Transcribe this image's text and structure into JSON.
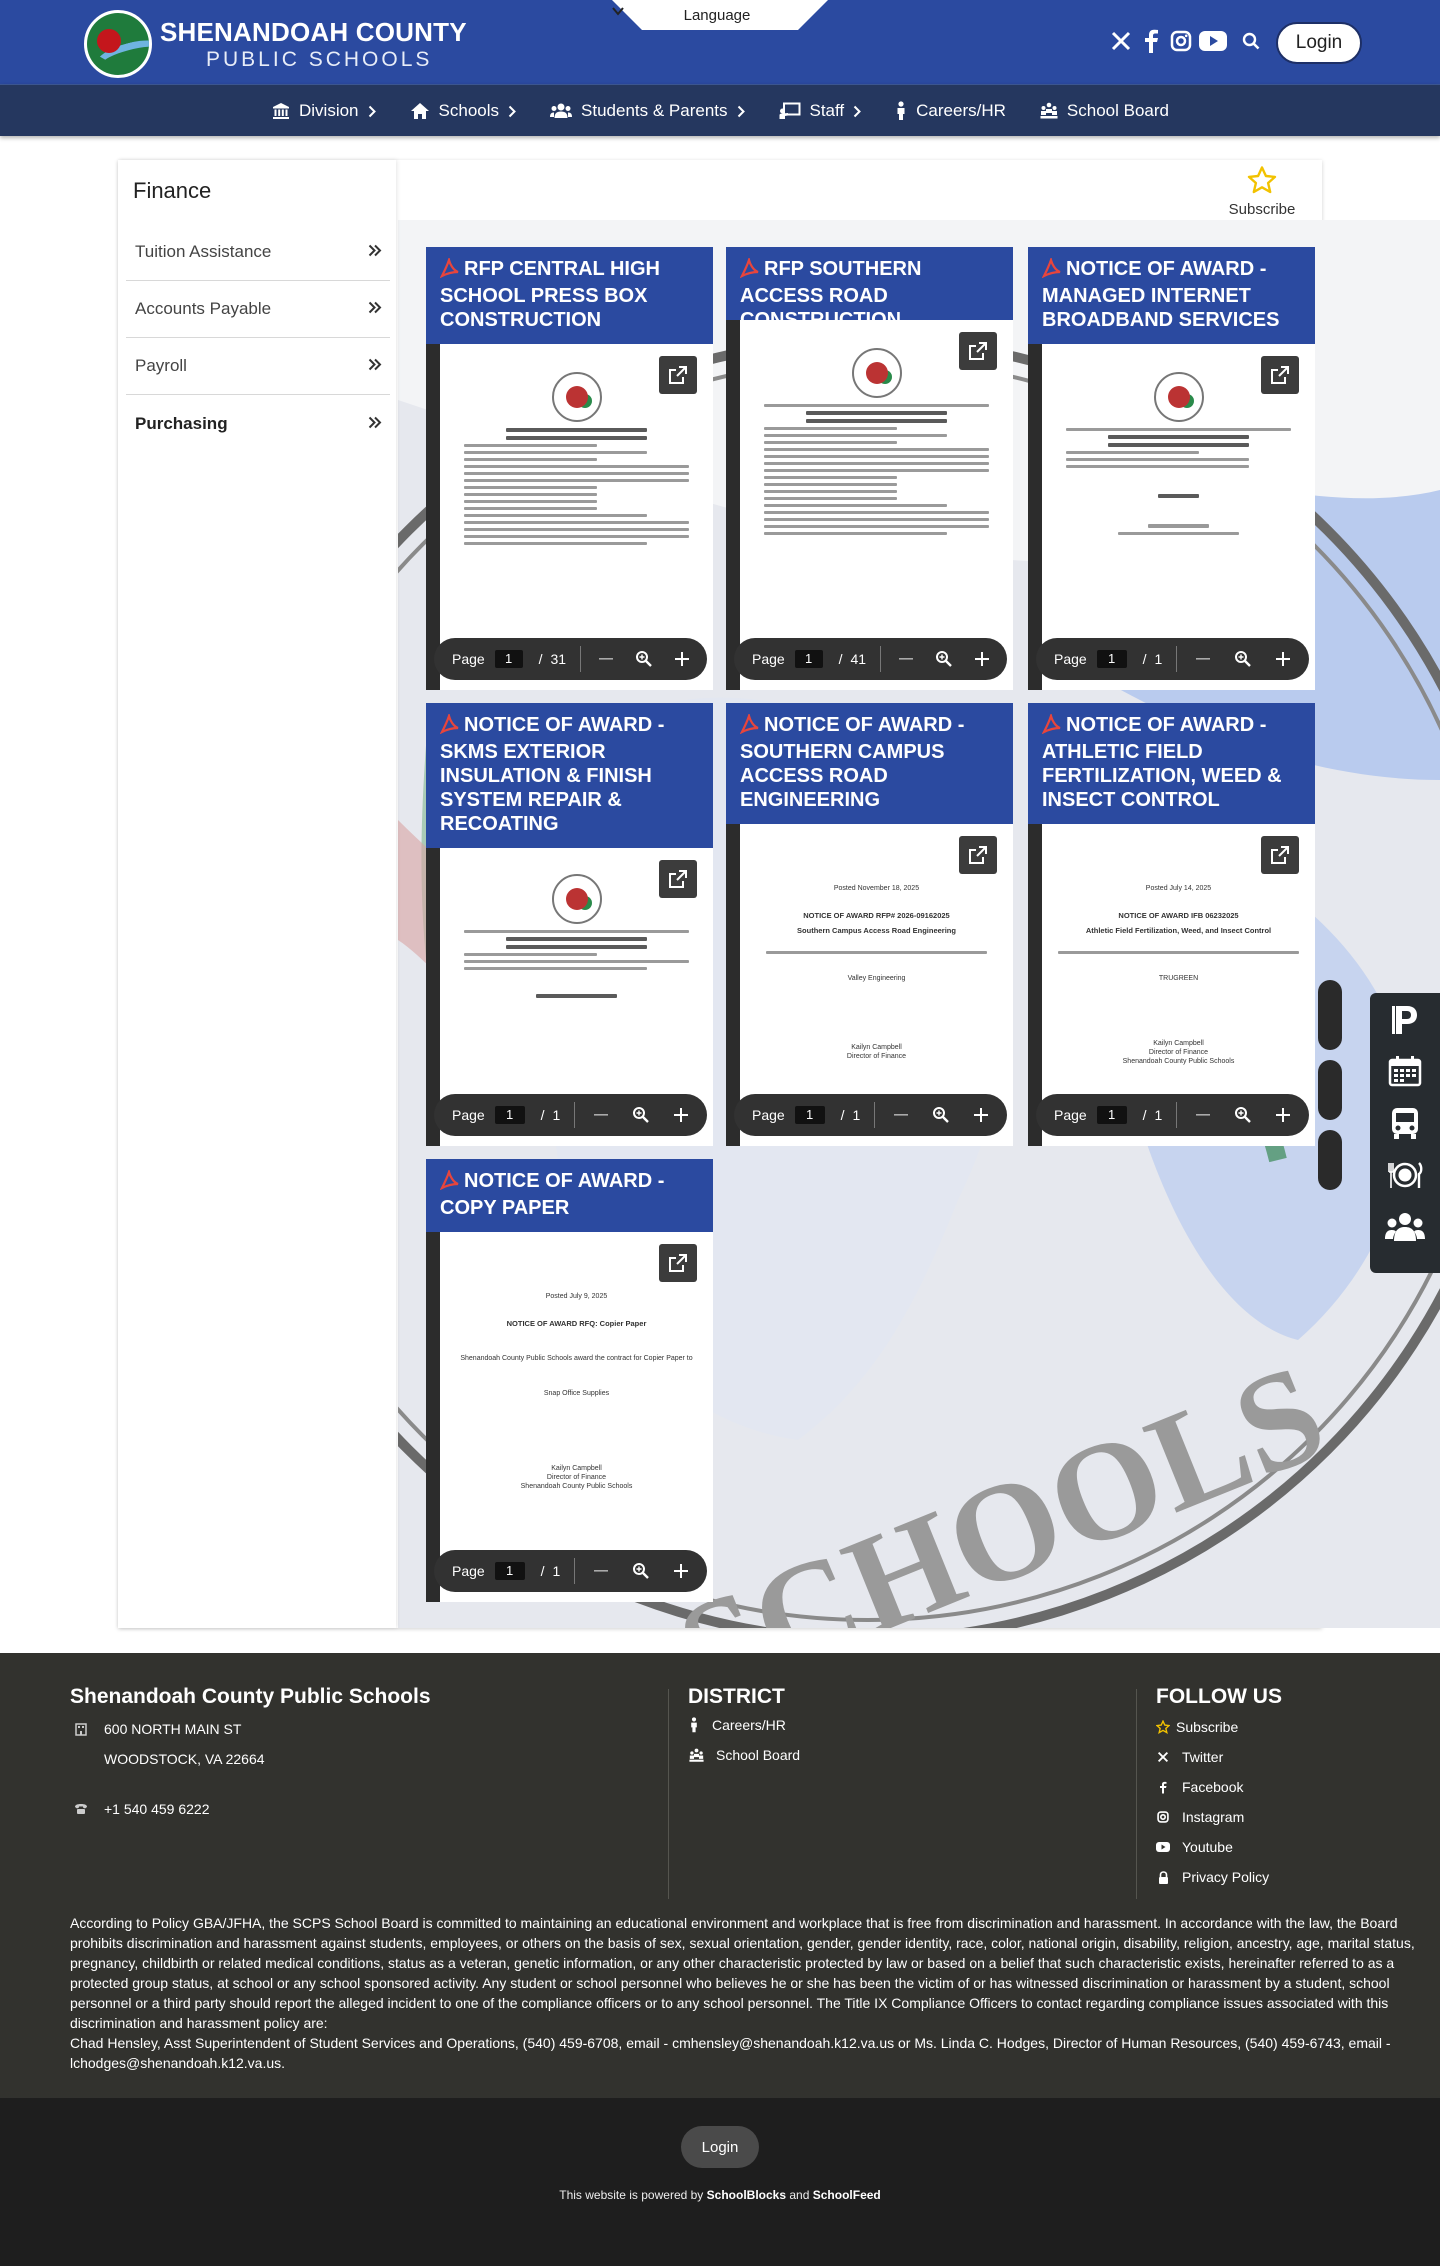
{
  "header": {
    "logo_line1": "SHENANDOAH COUNTY",
    "logo_line2": "PUBLIC SCHOOLS",
    "language_label": "Language",
    "login_label": "Login"
  },
  "nav": {
    "items": [
      {
        "label": "Division",
        "icon": "bank-icon",
        "has_chevron": true
      },
      {
        "label": "Schools",
        "icon": "home-icon",
        "has_chevron": true
      },
      {
        "label": "Students & Parents",
        "icon": "users-icon",
        "has_chevron": true
      },
      {
        "label": "Staff",
        "icon": "chalkboard-icon",
        "has_chevron": true
      },
      {
        "label": "Careers/HR",
        "icon": "person-icon",
        "has_chevron": false
      },
      {
        "label": "School Board",
        "icon": "group-icon",
        "has_chevron": false
      }
    ]
  },
  "page": {
    "title": "Finance",
    "subscribe_label": "Subscribe"
  },
  "sidebar": {
    "items": [
      {
        "label": "Tuition Assistance",
        "active": false
      },
      {
        "label": "Accounts Payable",
        "active": false
      },
      {
        "label": "Payroll",
        "active": false
      },
      {
        "label": "Purchasing",
        "active": true
      }
    ]
  },
  "documents": [
    {
      "title": "RFP CENTRAL HIGH SCHOOL PRESS BOX CONSTRUCTION",
      "page_label": "Page",
      "current_page": "1",
      "total_pages": "31"
    },
    {
      "title": "RFP SOUTHERN ACCESS ROAD CONSTRUCTION",
      "page_label": "Page",
      "current_page": "1",
      "total_pages": "41"
    },
    {
      "title": "NOTICE OF AWARD - MANAGED INTERNET BROADBAND SERVICES",
      "page_label": "Page",
      "current_page": "1",
      "total_pages": "1"
    },
    {
      "title": "NOTICE OF AWARD - SKMS EXTERIOR INSULATION & FINISH SYSTEM REPAIR & RECOATING",
      "page_label": "Page",
      "current_page": "1",
      "total_pages": "1"
    },
    {
      "title": "NOTICE OF AWARD - SOUTHERN CAMPUS ACCESS ROAD ENGINEERING",
      "page_label": "Page",
      "current_page": "1",
      "total_pages": "1"
    },
    {
      "title": "NOTICE OF AWARD - ATHLETIC FIELD FERTILIZATION, WEED & INSECT CONTROL",
      "page_label": "Page",
      "current_page": "1",
      "total_pages": "1"
    },
    {
      "title": "NOTICE OF AWARD - COPY PAPER",
      "page_label": "Page",
      "current_page": "1",
      "total_pages": "1"
    }
  ],
  "doc_previews": {
    "d5": {
      "posted": "Posted November 18, 2025",
      "heading": "NOTICE OF AWARD RFP# 2026-09162025",
      "subheading": "Southern Campus Access Road Engineering",
      "award": "Valley Engineering",
      "sign1": "Kailyn Campbell",
      "sign2": "Director of Finance"
    },
    "d6": {
      "posted": "Posted July 14, 2025",
      "heading": "NOTICE OF AWARD IFB 06232025",
      "subheading": "Athletic Field Fertilization, Weed, and Insect Control",
      "award": "TRUGREEN",
      "sign1": "Kailyn Campbell",
      "sign2": "Director of Finance",
      "sign3": "Shenandoah County Public Schools"
    },
    "d7": {
      "posted": "Posted July 9, 2025",
      "heading": "NOTICE OF AWARD RFQ: Copier Paper",
      "body": "Shenandoah County Public Schools award the contract for Copier Paper to",
      "award": "Snap Office Supplies",
      "sign1": "Kailyn Campbell",
      "sign2": "Director of Finance",
      "sign3": "Shenandoah County Public Schools"
    }
  },
  "footer": {
    "org_name": "Shenandoah County Public Schools",
    "address1": "600 NORTH MAIN ST",
    "address2": "WOODSTOCK, VA 22664",
    "phone": "+1 540 459 6222",
    "district_title": "DISTRICT",
    "district_links": [
      "Careers/HR",
      "School Board"
    ],
    "follow_title": "FOLLOW US",
    "follow_links": [
      "Subscribe",
      "Twitter",
      "Facebook",
      "Instagram",
      "Youtube",
      "Privacy Policy"
    ],
    "policy_text": "According to Policy GBA/JFHA, the SCPS School Board is committed to maintaining an educational environment and workplace that is free from discrimination and harassment. In accordance with the law, the Board prohibits discrimination and harassment against students, employees, or others on the basis of sex, sexual orientation, gender, gender identity, race, color, national origin, disability, religion, ancestry, age, marital status, pregnancy, childbirth or related medical conditions, status as a veteran, genetic information, or any other characteristic protected by law or based on a belief that such characteristic exists, hereinafter referred to as a protected group status, at school or any school sponsored activity. Any student or school personnel who believes he or she has been the victim of or has witnessed discrimination or harassment by a student, school personnel or a third party should report the alleged incident to one of the compliance officers or to any school personnel. The Title IX Compliance Officers to contact regarding compliance issues associated with this discrimination and harassment policy are:",
    "policy_contacts": "Chad Hensley, Asst Superintendent of Student Services and Operations, (540) 459-6708, email - cmhensley@shenandoah.k12.va.us or Ms. Linda C. Hodges, Director of Human Resources, (540) 459-6743, email - lchodges@shenandoah.k12.va.us.",
    "bottom_login": "Login",
    "powered_prefix": "This website is powered by",
    "powered_by1": "SchoolBlocks",
    "powered_and": "and",
    "powered_by2": "SchoolFeed"
  },
  "colors": {
    "brand_blue": "#2b4aa0",
    "nav_navy": "#25375f",
    "footer_bg": "#32322e",
    "bottom_bg": "#1e1e1e",
    "accent_yellow": "#f2c200"
  }
}
